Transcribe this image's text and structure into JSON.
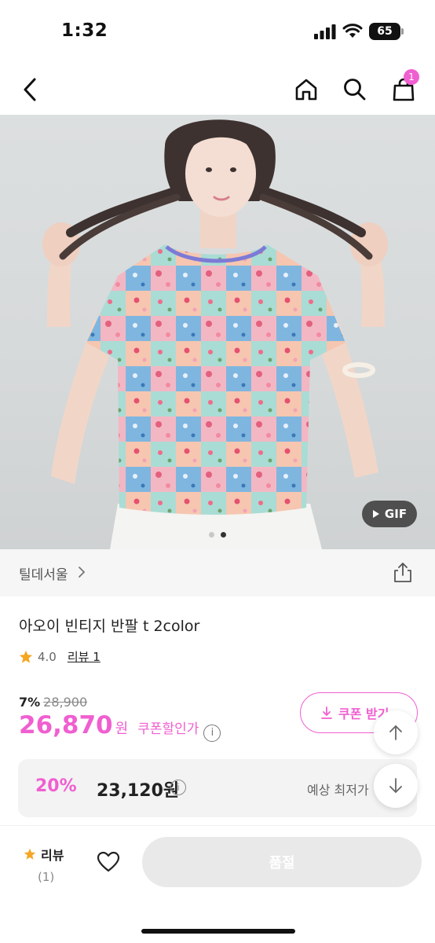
{
  "status_bar": {
    "time": "1:32",
    "battery": "65"
  },
  "nav": {
    "cart_count": "1"
  },
  "image": {
    "gif_label": "GIF"
  },
  "brand": {
    "name": "틸데서울"
  },
  "product": {
    "title": "아오이 빈티지 반팔 t 2color",
    "rating": "4.0",
    "review_label": "리뷰 1",
    "discount_rate": "7%",
    "original_price": "28,900",
    "sale_price": "26,870",
    "currency": "원",
    "coupon_price_label": "쿠폰할인가"
  },
  "coupon_button": {
    "label": "쿠폰 받기"
  },
  "estimate": {
    "rate": "20%",
    "price": "23,120원",
    "label": "예상 최저가"
  },
  "bottom": {
    "review_label": "리뷰",
    "review_count": "(1)",
    "buy_label": "품절"
  },
  "colors": {
    "accent": "#f05fd0",
    "star": "#f5a623"
  },
  "icons": [
    "back-icon",
    "home-icon",
    "search-icon",
    "cart-icon",
    "share-icon",
    "info-icon",
    "download-icon",
    "arrow-up-icon",
    "arrow-down-icon",
    "star-icon",
    "heart-icon",
    "play-icon"
  ]
}
